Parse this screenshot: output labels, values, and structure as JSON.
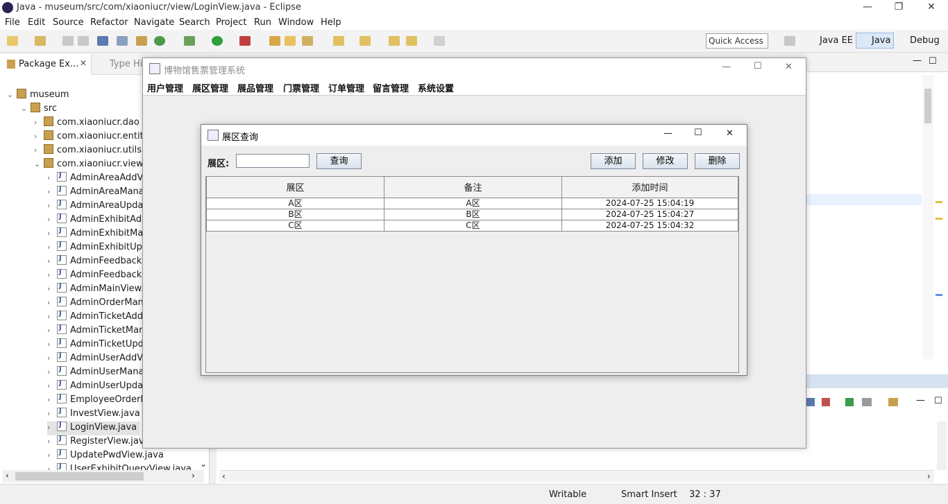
{
  "eclipse": {
    "title": "Java - museum/src/com/xiaoniucr/view/LoginView.java - Eclipse",
    "menu": [
      "File",
      "Edit",
      "Source",
      "Refactor",
      "Navigate",
      "Search",
      "Project",
      "Run",
      "Window",
      "Help"
    ],
    "quick_access": "Quick Access",
    "perspectives": [
      "Java EE",
      "Java",
      "Debug"
    ],
    "tabs": {
      "package_explorer": "Package Ex...",
      "type_hierarchy": "Type Hie"
    },
    "tree": {
      "project": "museum",
      "src": "src",
      "packages": [
        "com.xiaoniucr.dao",
        "com.xiaoniucr.entity",
        "com.xiaoniucr.utils",
        "com.xiaoniucr.view"
      ],
      "files": [
        "AdminAreaAddVi",
        "AdminAreaManag",
        "AdminAreaUpdat",
        "AdminExhibitAdd",
        "AdminExhibitMan",
        "AdminExhibitUpd",
        "AdminFeedbackM",
        "AdminFeedbackR",
        "AdminMainView.j",
        "AdminOrderMana",
        "AdminTicketAddV",
        "AdminTicketMana",
        "AdminTicketUpda",
        "AdminUserAddVi",
        "AdminUserManag",
        "AdminUserUpdat",
        "EmployeeOrderM",
        "InvestView.java",
        "LoginView.java",
        "RegisterView.java",
        "UpdatePwdView.java",
        "UserExhibitQueryView.java"
      ]
    },
    "status": {
      "writable": "Writable",
      "insert": "Smart Insert",
      "position": "32 : 37"
    }
  },
  "app": {
    "title": "博物馆售票管理系统",
    "menu": [
      "用户管理",
      "展区管理",
      "展品管理",
      "门票管理",
      "订单管理",
      "留言管理",
      "系统设置"
    ]
  },
  "dialog": {
    "title": "展区查询",
    "search_label": "展区:",
    "search_value": "",
    "buttons": {
      "query": "查询",
      "add": "添加",
      "edit": "修改",
      "delete": "删除"
    },
    "table": {
      "headers": [
        "展区",
        "备注",
        "添加时间"
      ],
      "rows": [
        [
          "A区",
          "A区",
          "2024-07-25 15:04:19"
        ],
        [
          "B区",
          "B区",
          "2024-07-25 15:04:27"
        ],
        [
          "C区",
          "C区",
          "2024-07-25 15:04:32"
        ]
      ]
    }
  }
}
